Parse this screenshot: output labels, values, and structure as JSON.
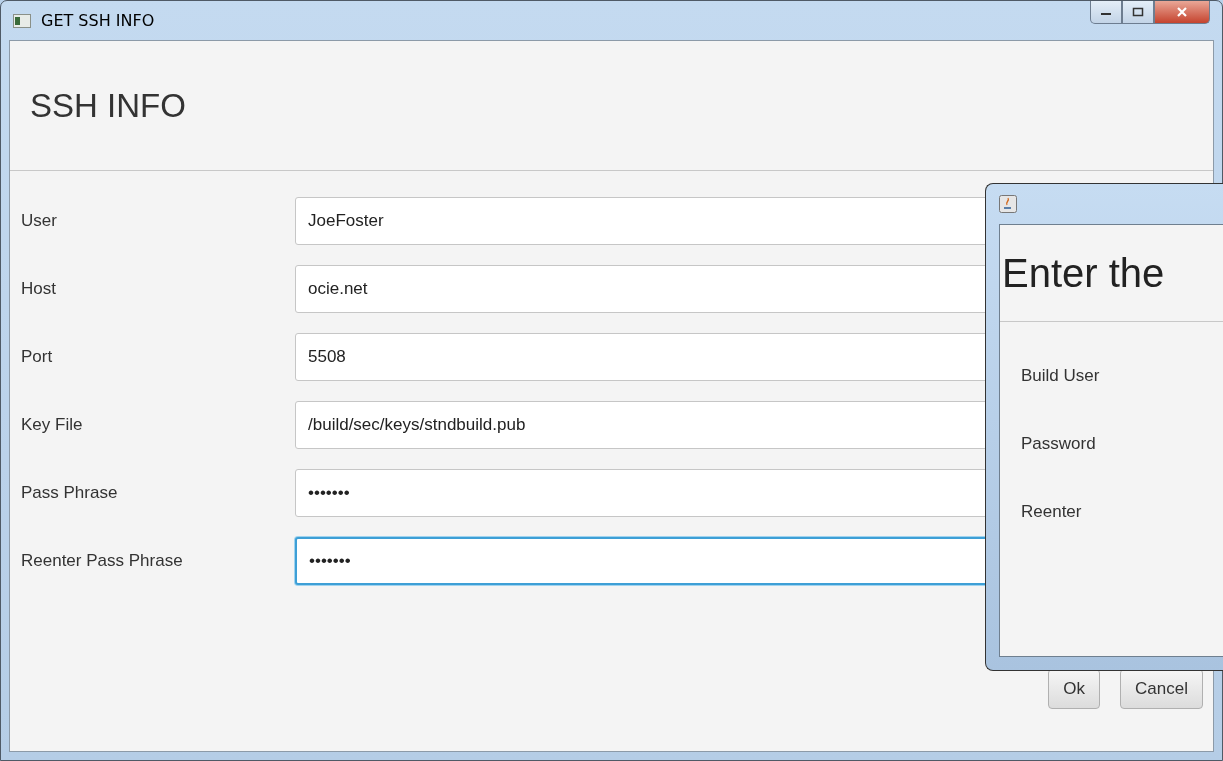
{
  "window": {
    "title": "GET SSH INFO"
  },
  "header": {
    "title": "SSH INFO"
  },
  "fields": [
    {
      "label": "User",
      "value": "JoeFoster",
      "focused": false
    },
    {
      "label": "Host",
      "value": "ocie.net",
      "focused": false
    },
    {
      "label": "Port",
      "value": "5508",
      "focused": false
    },
    {
      "label": "Key File",
      "value": "/build/sec/keys/stndbuild.pub",
      "focused": false
    },
    {
      "label": "Pass Phrase",
      "value": "•••••••",
      "focused": false
    },
    {
      "label": "Reenter Pass Phrase",
      "value": "•••••••",
      "focused": true
    }
  ],
  "buttons": [
    "Ok",
    "Cancel"
  ],
  "dialog": {
    "heading": "Enter the",
    "labels": [
      "Build User",
      "Password",
      "Reenter"
    ]
  }
}
